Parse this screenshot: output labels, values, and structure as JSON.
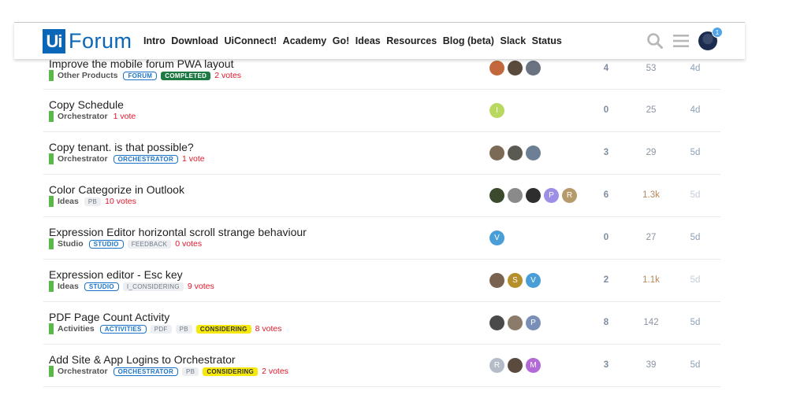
{
  "header": {
    "logo_box": "Ui",
    "logo_text": "Forum",
    "nav": [
      "Intro",
      "Download",
      "UiConnect!",
      "Academy",
      "Go!",
      "Ideas",
      "Resources",
      "Blog (beta)",
      "Slack",
      "Status"
    ],
    "notification_count": "1",
    "icons": [
      "search-icon",
      "hamburger-menu-icon",
      "user-avatar"
    ]
  },
  "topics": [
    {
      "title": "Improve the mobile forum PWA layout",
      "category": "Other Products",
      "category_color": "#5ab84a",
      "tags": [
        {
          "label": "FORUM",
          "style": "outline"
        },
        {
          "label": "COMPLETED",
          "style": "green"
        }
      ],
      "votes": "2 votes",
      "posters": [
        {
          "bg": "#c2683c",
          "text": ""
        },
        {
          "bg": "#5a4a3c",
          "text": ""
        },
        {
          "bg": "#6b7380",
          "text": ""
        }
      ],
      "replies": "4",
      "views": "53",
      "activity": "4d"
    },
    {
      "title": "Copy Schedule",
      "category": "Orchestrator",
      "category_color": "#5ab84a",
      "tags": [],
      "votes": "1 vote",
      "posters": [
        {
          "bg": "#b8d860",
          "text": "I"
        }
      ],
      "replies": "0",
      "views": "25",
      "activity": "4d"
    },
    {
      "title": "Copy tenant. is that possible?",
      "category": "Orchestrator",
      "category_color": "#5ab84a",
      "tags": [
        {
          "label": "ORCHESTRATOR",
          "style": "outline"
        }
      ],
      "votes": "1 vote",
      "posters": [
        {
          "bg": "#7b6a55",
          "text": ""
        },
        {
          "bg": "#5b5a52",
          "text": ""
        },
        {
          "bg": "#6c7f95",
          "text": ""
        }
      ],
      "replies": "3",
      "views": "29",
      "activity": "5d"
    },
    {
      "title": "Color Categorize in Outlook",
      "category": "Ideas",
      "category_color": "#5ab84a",
      "tags": [
        {
          "label": "PB",
          "style": "grey"
        }
      ],
      "votes": "10 votes",
      "posters": [
        {
          "bg": "#3b4a2c",
          "text": ""
        },
        {
          "bg": "#8a8a8a",
          "text": ""
        },
        {
          "bg": "#2e2e2e",
          "text": ""
        },
        {
          "bg": "#9d8ee6",
          "text": "P"
        },
        {
          "bg": "#b59a6b",
          "text": "R"
        }
      ],
      "replies": "6",
      "views": "1.3k",
      "views_hot": true,
      "activity": "5d",
      "activity_faded": true
    },
    {
      "title": "Expression Editor horizontal scroll strange behaviour",
      "category": "Studio",
      "category_color": "#5ab84a",
      "tags": [
        {
          "label": "STUDIO",
          "style": "outline"
        },
        {
          "label": "FEEDBACK",
          "style": "grey"
        }
      ],
      "votes": "0 votes",
      "posters": [
        {
          "bg": "#4a9ed8",
          "text": "V"
        }
      ],
      "replies": "0",
      "views": "27",
      "activity": "5d"
    },
    {
      "title": "Expression editor - Esc key",
      "category": "Ideas",
      "category_color": "#5ab84a",
      "tags": [
        {
          "label": "STUDIO",
          "style": "outline"
        },
        {
          "label": "I_CONSIDERING",
          "style": "grey"
        }
      ],
      "votes": "9 votes",
      "posters": [
        {
          "bg": "#7a6250",
          "text": ""
        },
        {
          "bg": "#b58f2c",
          "text": "S"
        },
        {
          "bg": "#4a9ed8",
          "text": "V"
        }
      ],
      "replies": "2",
      "views": "1.1k",
      "views_hot": true,
      "activity": "5d",
      "activity_faded": true
    },
    {
      "title": "PDF Page Count Activity",
      "category": "Activities",
      "category_color": "#5ab84a",
      "tags": [
        {
          "label": "ACTIVITIES",
          "style": "outline"
        },
        {
          "label": "PDF",
          "style": "grey"
        },
        {
          "label": "PB",
          "style": "grey"
        },
        {
          "label": "CONSIDERING",
          "style": "yellow"
        }
      ],
      "votes": "8 votes",
      "posters": [
        {
          "bg": "#4a4a4a",
          "text": ""
        },
        {
          "bg": "#8b7b6b",
          "text": ""
        },
        {
          "bg": "#7a8fb8",
          "text": "P"
        }
      ],
      "replies": "8",
      "views": "142",
      "activity": "5d"
    },
    {
      "title": "Add Site & App Logins to Orchestrator",
      "category": "Orchestrator",
      "category_color": "#5ab84a",
      "tags": [
        {
          "label": "ORCHESTRATOR",
          "style": "outline"
        },
        {
          "label": "PB",
          "style": "grey"
        },
        {
          "label": "CONSIDERING",
          "style": "yellow"
        }
      ],
      "votes": "2 votes",
      "posters": [
        {
          "bg": "#b4bcc8",
          "text": "R"
        },
        {
          "bg": "#5b4a3e",
          "text": ""
        },
        {
          "bg": "#b36ad6",
          "text": "M"
        }
      ],
      "replies": "3",
      "views": "39",
      "activity": "5d"
    }
  ]
}
